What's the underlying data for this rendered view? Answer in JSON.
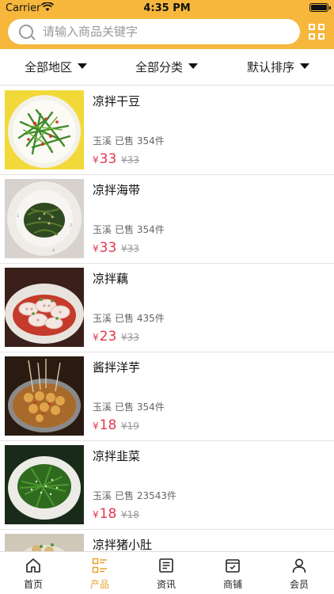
{
  "status": {
    "carrier": "Carrier",
    "time": "4:35 PM"
  },
  "search": {
    "placeholder": "请输入商品关键字"
  },
  "filters": [
    {
      "label": "全部地区"
    },
    {
      "label": "全部分类"
    },
    {
      "label": "默认排序"
    }
  ],
  "products": [
    {
      "name": "凉拌干豆",
      "region": "玉溪",
      "sold": "已售 354件",
      "price": "33",
      "original_price": "¥33",
      "image": "green-vegetable-plate"
    },
    {
      "name": "凉拌海带",
      "region": "玉溪",
      "sold": "已售 354件",
      "price": "33",
      "original_price": "¥33",
      "image": "seaweed-plate"
    },
    {
      "name": "凉拌藕",
      "region": "玉溪",
      "sold": "已售 435件",
      "price": "23",
      "original_price": "¥33",
      "image": "lotus-root-plate"
    },
    {
      "name": "酱拌洋芋",
      "region": "玉溪",
      "sold": "已售 354件",
      "price": "18",
      "original_price": "¥19",
      "image": "potato-skewers-plate"
    },
    {
      "name": "凉拌韭菜",
      "region": "玉溪",
      "sold": "已售 23543件",
      "price": "18",
      "original_price": "¥18",
      "image": "chives-plate"
    },
    {
      "name": "凉拌猪小肚",
      "region": "",
      "sold": "",
      "price": "",
      "original_price": "",
      "image": "pork-plate"
    }
  ],
  "currency": "¥",
  "tabs": [
    {
      "label": "首页",
      "icon": "home-icon"
    },
    {
      "label": "产品",
      "icon": "product-list-icon",
      "active": true
    },
    {
      "label": "资讯",
      "icon": "news-icon"
    },
    {
      "label": "商铺",
      "icon": "shop-icon"
    },
    {
      "label": "会员",
      "icon": "member-icon"
    }
  ],
  "colors": {
    "header": "#f6b73c",
    "price": "#e2384d",
    "active_tab": "#e7a12b"
  }
}
